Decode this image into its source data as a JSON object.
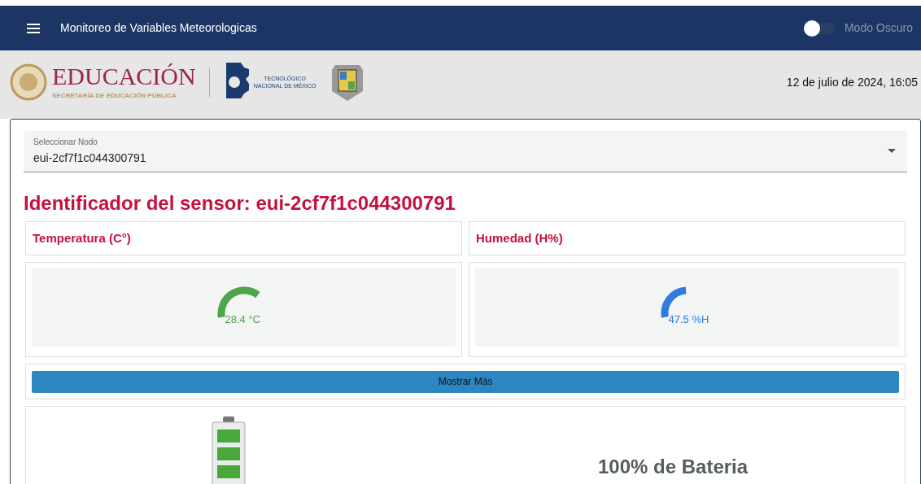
{
  "app_bar": {
    "title": "Monitoreo de Variables Meteorologicas",
    "dark_mode": {
      "label": "Modo Oscuro",
      "on": false
    }
  },
  "header": {
    "logo_title": "EDUCACIÓN",
    "logo_subtitle": "SECRETARÍA DE EDUCACIÓN PÚBLICA",
    "tec_line_1": "TECNOLÓGICO",
    "tec_line_2": "NACIONAL DE MÉXICO",
    "datetime": "12 de julio de 2024, 16:05"
  },
  "node_select": {
    "label": "Seleccionar Nodo",
    "value": "eui-2cf7f1c044300791"
  },
  "sensor_title": "Identificador del sensor: eui-2cf7f1c044300791",
  "gauges": [
    {
      "title": "Temperatura (C°)",
      "reading": "28.4 °C",
      "color": "#4fa44e"
    },
    {
      "title": "Humedad (H%)",
      "reading": "47.5 %H",
      "color": "#2f7be0"
    }
  ],
  "more_button": "Mostrar Más",
  "battery": {
    "label": "100% de Bateria"
  }
}
